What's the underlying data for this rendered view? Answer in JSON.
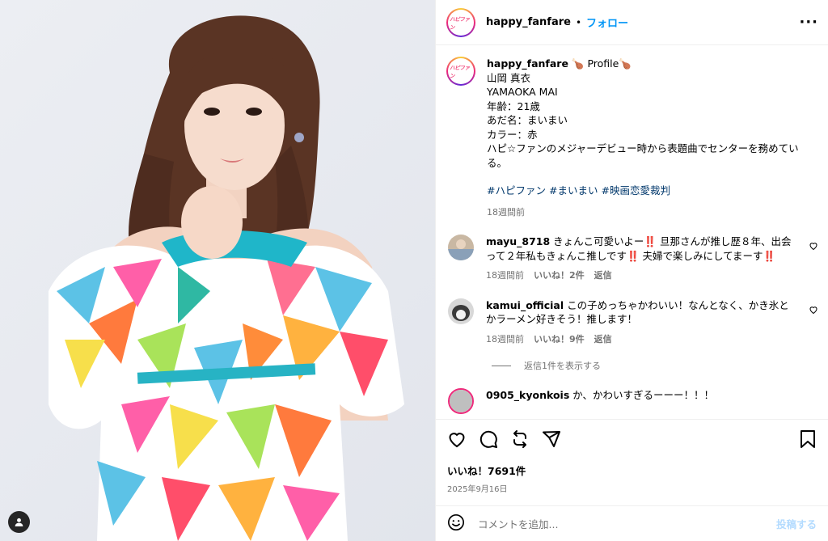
{
  "header": {
    "username": "happy_fanfare",
    "separator": "•",
    "follow_label": "フォロー",
    "more_label": "···"
  },
  "avatar_text": "ハピファン",
  "caption": {
    "username": "happy_fanfare",
    "lines": [
      "🍗 Profile🍗",
      "山岡 真衣",
      "YAMAOKA MAI",
      "年齢：21歳",
      "あだ名：まいまい",
      "カラー：赤",
      "ハピ☆ファンのメジャーデビュー時から表題曲でセンターを務めている。"
    ],
    "hashtags": [
      "#ハピファン",
      "#まいまい",
      "#映画恋愛裁判"
    ],
    "time": "18週間前"
  },
  "comments": [
    {
      "username": "mayu_8718",
      "text": "きょんこ可愛いよー‼️ 旦那さんが推し歴８年、出会って２年私もきょんこ推しです‼️ 夫婦で楽しみにしてまーす‼️",
      "time": "18週間前",
      "likes": "いいね！2件",
      "reply": "返信"
    },
    {
      "username": "kamui_official",
      "text": "この子めっちゃかわいい！なんとなく、かき氷とかラーメン好きそう！推します！",
      "time": "18週間前",
      "likes": "いいね！9件",
      "reply": "返信"
    },
    {
      "username": "0905_kyonkois",
      "text": "か、かわいすぎるーーー！！！"
    }
  ],
  "view_replies": "返信1件を表示する",
  "likes_count": "いいね！7691件",
  "post_date": "2025年9月16日",
  "comment_placeholder": "コメントを追加...",
  "post_label": "投稿する",
  "colors": {
    "link": "#0095f6",
    "hashtag": "#00376b",
    "muted": "#737373",
    "post_disabled": "#b3dbff"
  },
  "icons": [
    "user-tag-icon",
    "more-icon",
    "heart-icon",
    "comment-icon",
    "repost-icon",
    "share-icon",
    "bookmark-icon",
    "emoji-icon"
  ]
}
